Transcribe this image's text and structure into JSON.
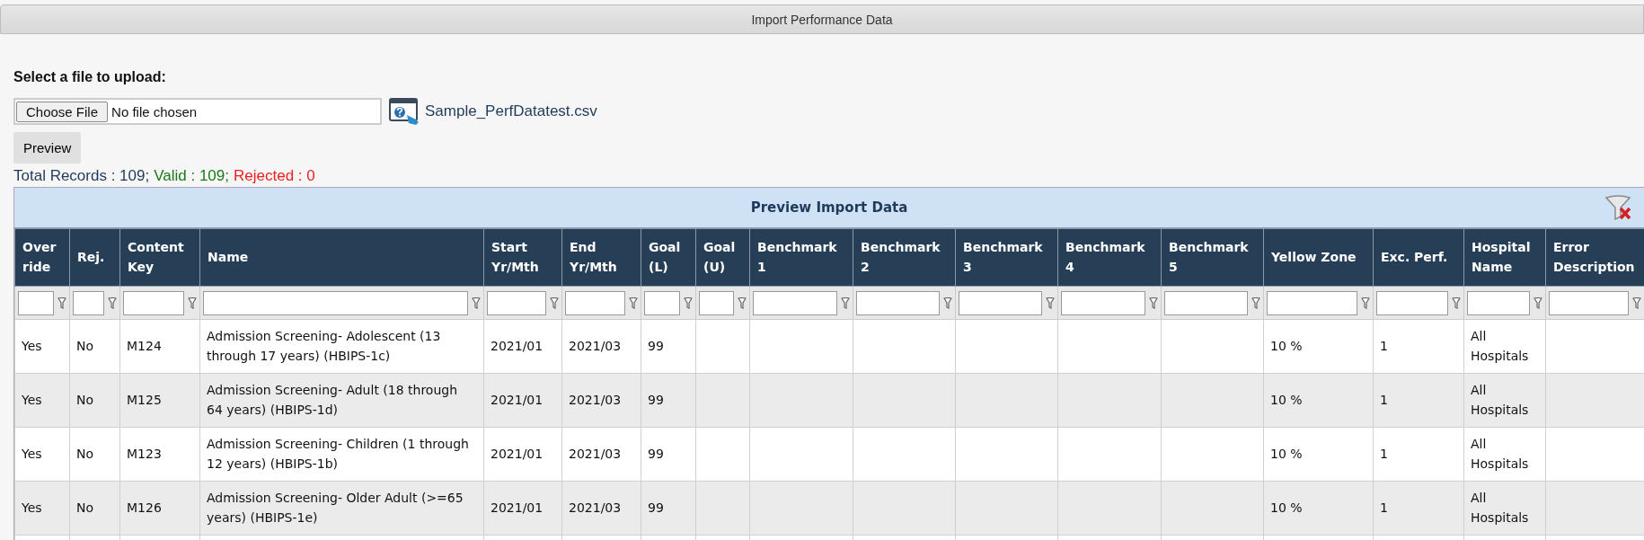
{
  "window": {
    "title": "Import Performance Data"
  },
  "upload": {
    "label": "Select a file to upload:",
    "choose_button": "Choose File",
    "file_status": "No file chosen",
    "sample_link": "Sample_PerfDatatest.csv"
  },
  "preview_button": "Preview",
  "summary": [
    {
      "text": "Total Records : 109;",
      "color": "#1f3a5a"
    },
    {
      "text": "Valid : 109;",
      "color": "#1a7a1a"
    },
    {
      "text": "Rejected : 0",
      "color": "#f02020"
    }
  ],
  "table": {
    "title": "Preview Import Data",
    "columns": [
      "Over ride",
      "Rej.",
      "Content Key",
      "Name",
      "Start Yr/Mth",
      "End Yr/Mth",
      "Goal (L)",
      "Goal (U)",
      "Benchmark 1",
      "Benchmark 2",
      "Benchmark 3",
      "Benchmark 4",
      "Benchmark 5",
      "Yellow Zone",
      "Exc. Perf.",
      "Hospital Name",
      "Error Description"
    ],
    "rows": [
      {
        "cells": [
          "Yes",
          "No",
          "M124",
          "Admission Screening- Adolescent (13 through 17 years) (HBIPS-1c)",
          "2021/01",
          "2021/03",
          "99",
          null,
          null,
          null,
          null,
          null,
          null,
          "10 %",
          "1",
          "All Hospitals",
          null
        ]
      },
      {
        "cells": [
          "Yes",
          "No",
          "M125",
          "Admission Screening- Adult (18 through 64 years) (HBIPS-1d)",
          "2021/01",
          "2021/03",
          "99",
          null,
          null,
          null,
          null,
          null,
          null,
          "10 %",
          "1",
          "All Hospitals",
          null
        ]
      },
      {
        "cells": [
          "Yes",
          "No",
          "M123",
          "Admission Screening- Children (1 through 12 years) (HBIPS-1b)",
          "2021/01",
          "2021/03",
          "99",
          null,
          null,
          null,
          null,
          null,
          null,
          "10 %",
          "1",
          "All Hospitals",
          null
        ]
      },
      {
        "cells": [
          "Yes",
          "No",
          "M126",
          "Admission Screening- Older Adult (>=65 years) (HBIPS-1e)",
          "2021/01",
          "2021/03",
          "99",
          null,
          null,
          null,
          null,
          null,
          null,
          "10 %",
          "1",
          "All Hospitals",
          null
        ]
      }
    ]
  }
}
